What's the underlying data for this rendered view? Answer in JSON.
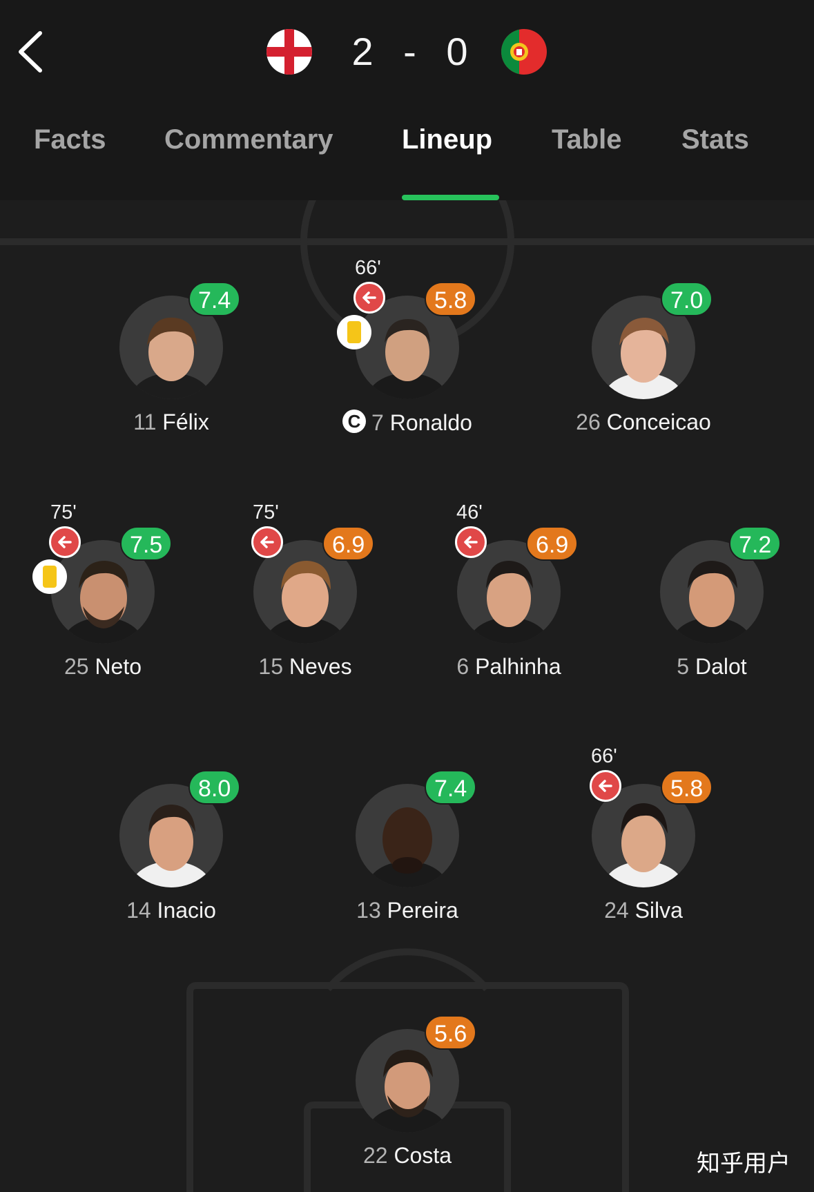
{
  "header": {
    "home_flag": "england-flag",
    "away_flag": "portugal-flag",
    "score_home": "2",
    "score_sep": "-",
    "score_away": "0"
  },
  "tabs": [
    {
      "label": "Facts",
      "active": false
    },
    {
      "label": "Commentary",
      "active": false
    },
    {
      "label": "Lineup",
      "active": true
    },
    {
      "label": "Table",
      "active": false
    },
    {
      "label": "Stats",
      "active": false
    }
  ],
  "colors": {
    "accent": "#27c25b",
    "rating_good": "#25b85a",
    "rating_avg": "#e3781c",
    "sub_out": "#e04848",
    "yellow_card": "#f5c518"
  },
  "players": {
    "felix": {
      "number": "11",
      "name": "Félix",
      "rating": "7.4"
    },
    "ronaldo": {
      "number": "7",
      "name": "Ronaldo",
      "rating": "5.8",
      "sub_time": "66'",
      "captain": "C"
    },
    "conceicao": {
      "number": "26",
      "name": "Conceicao",
      "rating": "7.0"
    },
    "neto": {
      "number": "25",
      "name": "Neto",
      "rating": "7.5",
      "sub_time": "75'"
    },
    "neves": {
      "number": "15",
      "name": "Neves",
      "rating": "6.9",
      "sub_time": "75'"
    },
    "palhinha": {
      "number": "6",
      "name": "Palhinha",
      "rating": "6.9",
      "sub_time": "46'"
    },
    "dalot": {
      "number": "5",
      "name": "Dalot",
      "rating": "7.2"
    },
    "inacio": {
      "number": "14",
      "name": "Inacio",
      "rating": "8.0"
    },
    "pereira": {
      "number": "13",
      "name": "Pereira",
      "rating": "7.4"
    },
    "silva": {
      "number": "24",
      "name": "Silva",
      "rating": "5.8",
      "sub_time": "66'"
    },
    "costa": {
      "number": "22",
      "name": "Costa",
      "rating": "5.6"
    }
  },
  "watermark": "知乎用户"
}
